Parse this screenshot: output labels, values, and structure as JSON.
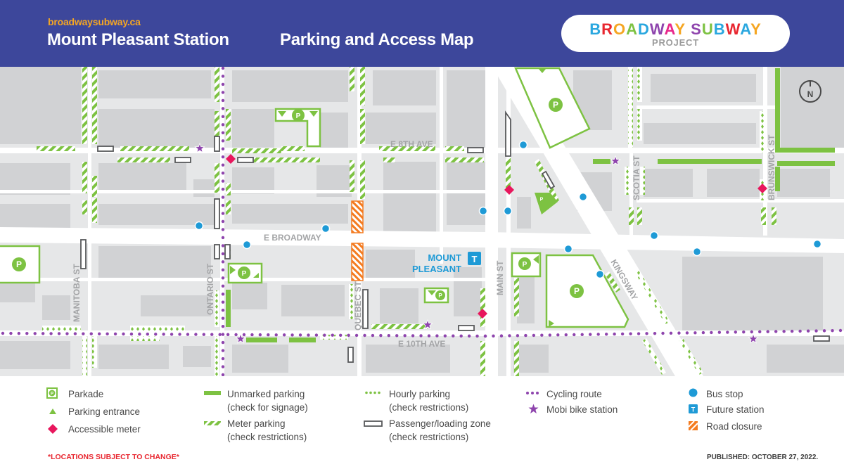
{
  "header": {
    "site_link": "broadwaysubway.ca",
    "station_title": "Mount Pleasant Station",
    "map_title": "Parking and Access Map",
    "logo": {
      "main_letters": [
        "B",
        "R",
        "O",
        "A",
        "D",
        "W",
        "A",
        "Y",
        " ",
        "S",
        "U",
        "B",
        "W",
        "A",
        "Y"
      ],
      "main_colors": [
        "#2aa7df",
        "#e8262f",
        "#f5a623",
        "#7dc242",
        "#2aa7df",
        "#8e44ad",
        "#e8268a",
        "#f5a623",
        "#ffffff",
        "#8e44ad",
        "#7dc242",
        "#2aa7df",
        "#e8262f",
        "#2aa7df",
        "#f5a623"
      ],
      "sub": "PROJECT"
    }
  },
  "map": {
    "streets": {
      "e_8th_ave": "E 8TH AVE",
      "e_broadway": "E BROADWAY",
      "e_10th_ave": "E 10TH AVE",
      "manitoba_st": "MANITOBA ST",
      "ontario_st": "ONTARIO ST",
      "quebec_st": "QUEBEC ST",
      "main_st": "MAIN ST",
      "kingsway": "KINGSWAY",
      "scotia_st": "SCOTIA ST",
      "brunswick_st": "BRUNSWICK ST"
    },
    "station": {
      "line1": "MOUNT",
      "line2": "PLEASANT",
      "marker": "T"
    },
    "north_label": "N",
    "parkade_label": "P"
  },
  "legend": {
    "col1": [
      {
        "icon": "parkade-icon",
        "label": "Parkade"
      },
      {
        "icon": "parking-entrance-icon",
        "label": "Parking entrance"
      },
      {
        "icon": "accessible-meter-icon",
        "label": "Accessible meter"
      }
    ],
    "col2": [
      {
        "icon": "unmarked-parking-icon",
        "label1": "Unmarked parking",
        "label2": "(check for signage)"
      },
      {
        "icon": "meter-parking-icon",
        "label1": "Meter parking",
        "label2": "(check restrictions)"
      }
    ],
    "col3": [
      {
        "icon": "hourly-parking-icon",
        "label1": "Hourly parking",
        "label2": "(check restrictions)"
      },
      {
        "icon": "loading-zone-icon",
        "label1": "Passenger/loading zone",
        "label2": "(check restrictions)"
      }
    ],
    "col4": [
      {
        "icon": "cycling-route-icon",
        "label": "Cycling route"
      },
      {
        "icon": "mobi-bike-station-icon",
        "label": "Mobi bike station"
      }
    ],
    "col5": [
      {
        "icon": "bus-stop-icon",
        "label": "Bus stop"
      },
      {
        "icon": "future-station-icon",
        "label": "Future station"
      },
      {
        "icon": "road-closure-icon",
        "label": "Road closure"
      }
    ],
    "disclaimer": "*LOCATIONS SUBJECT TO CHANGE*",
    "published": "PUBLISHED: OCTOBER 27, 2022."
  },
  "colors": {
    "header_bg": "#3d479b",
    "site_link": "#f5a623",
    "green": "#7dc242",
    "accessible": "#e8175d",
    "bus": "#1e9ad6",
    "cycling": "#8e44ad",
    "closure": "#f47b20",
    "building": "#d1d2d4",
    "block": "#e6e7e8"
  }
}
